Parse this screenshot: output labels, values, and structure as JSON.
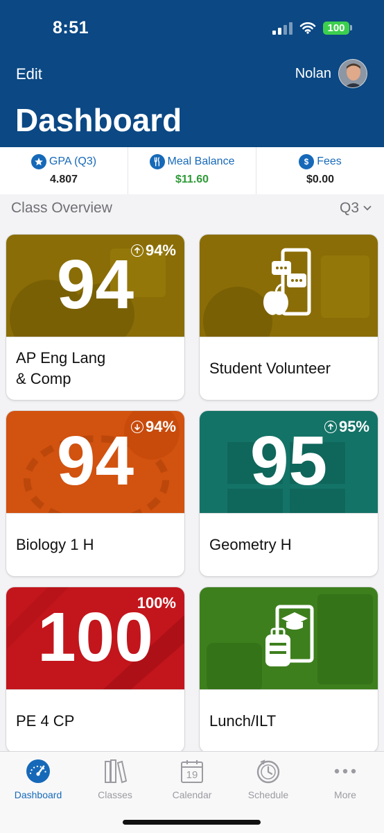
{
  "status_bar": {
    "time": "8:51",
    "battery": "100"
  },
  "header": {
    "edit_label": "Edit",
    "user_name": "Nolan",
    "title": "Dashboard"
  },
  "stats": [
    {
      "label": "GPA (Q3)",
      "value": "4.807",
      "icon": "star-icon"
    },
    {
      "label": "Meal Balance",
      "value": "$11.60",
      "icon": "utensils-icon"
    },
    {
      "label": "Fees",
      "value": "$0.00",
      "icon": "dollar-icon"
    }
  ],
  "overview": {
    "label": "Class Overview",
    "term": "Q3"
  },
  "classes": [
    {
      "name_line1": "AP Eng Lang",
      "name_line2": "& Comp",
      "grade": "94",
      "percent": "94%",
      "trend": "up",
      "color": "#8a6d06"
    },
    {
      "name_line1": "Student Volunteer",
      "name_line2": "",
      "grade": "",
      "percent": "",
      "trend": "",
      "color": "#8a6d06"
    },
    {
      "name_line1": "Biology 1 H",
      "name_line2": "",
      "grade": "94",
      "percent": "94%",
      "trend": "down",
      "color": "#d2520f"
    },
    {
      "name_line1": "Geometry H",
      "name_line2": "",
      "grade": "95",
      "percent": "95%",
      "trend": "up",
      "color": "#147367"
    },
    {
      "name_line1": "PE 4 CP",
      "name_line2": "",
      "grade": "100",
      "percent": "100%",
      "trend": "",
      "color": "#c3151c"
    },
    {
      "name_line1": "Lunch/ILT",
      "name_line2": "",
      "grade": "",
      "percent": "",
      "trend": "",
      "color": "#3d7f1d"
    }
  ],
  "tabs": [
    {
      "label": "Dashboard",
      "icon": "speedometer-icon",
      "active": true
    },
    {
      "label": "Classes",
      "icon": "books-icon",
      "active": false
    },
    {
      "label": "Calendar",
      "icon": "calendar-icon",
      "calendar_day": "19",
      "active": false
    },
    {
      "label": "Schedule",
      "icon": "clock-icon",
      "active": false
    },
    {
      "label": "More",
      "icon": "ellipsis-icon",
      "active": false
    }
  ]
}
